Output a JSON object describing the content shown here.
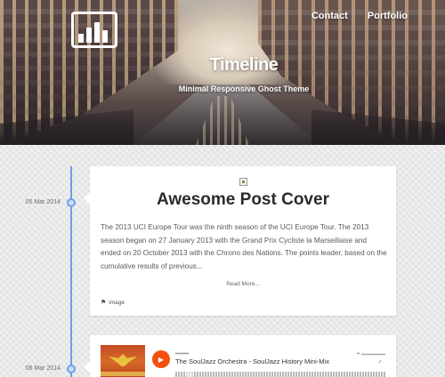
{
  "header": {
    "nav": [
      {
        "label": "Contact"
      },
      {
        "label": "Portfolio"
      }
    ],
    "title": "Timeline",
    "subtitle": "Minimal Responsive Ghost Theme"
  },
  "posts": [
    {
      "date": "05 Mar 2014",
      "title": "Awesome Post Cover",
      "excerpt": "The 2013 UCI Europe Tour was the ninth season of the UCI Europe Tour. The 2013 season began on 27 January 2013 with the Grand Prix Cycliste la Marseillaise and ended on 20 October 2013 with the Chrono des Nations. The points leader, based on the cumulative results of previous...",
      "read_more": "Read More...",
      "tag": "image"
    },
    {
      "date": "06 Mar 2014",
      "track": "The SoulJazz Orchestra - SoulJazz History Mini-Mix",
      "play_icon": "play-icon",
      "brand_icon": "soundcloud-icon"
    }
  ],
  "colors": {
    "timeline": "#6aa1e6",
    "soundcloud": "#f5500f"
  }
}
